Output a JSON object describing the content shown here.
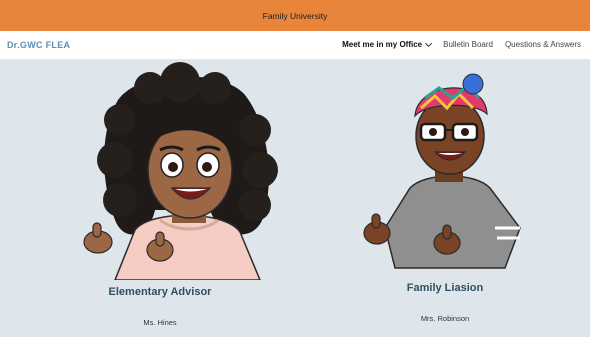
{
  "banner": {
    "text": "Family University"
  },
  "nav": {
    "brand": "Dr.GWC FLEA",
    "items": [
      {
        "label": "Meet me in my Office",
        "active": true,
        "icon": "chevron-down-icon"
      },
      {
        "label": "Bulletin Board"
      },
      {
        "label": "Questions & Answers"
      }
    ]
  },
  "staff": [
    {
      "role": "Elementary Advisor",
      "name": "Ms. Hines",
      "avatar": "bitmoji-curly-hair-thumbs-up"
    },
    {
      "role": "Family Liasion",
      "name": "Mrs. Robinson",
      "avatar": "bitmoji-headwrap-glasses-thumbs-up"
    }
  ],
  "colors": {
    "banner": "#e8853a",
    "brand": "#5b90b3",
    "background": "#dfe6eb",
    "role_text": "#2f5061"
  }
}
